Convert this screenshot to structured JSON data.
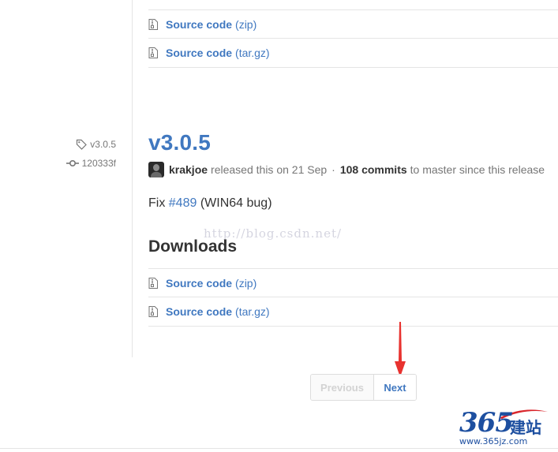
{
  "previous_release": {
    "downloads": [
      {
        "label": "Source code",
        "format": "(zip)"
      },
      {
        "label": "Source code",
        "format": "(tar.gz)"
      }
    ]
  },
  "release": {
    "tag": "v3.0.5",
    "commit": "120333f",
    "title": "v3.0.5",
    "author": "krakjoe",
    "released_text": "released this on 21 Sep",
    "separator": "·",
    "commits_count": "108 commits",
    "commits_suffix": "to master since this release",
    "notes_prefix": "Fix",
    "notes_issue": "#489",
    "notes_suffix": "(WIN64 bug)",
    "downloads_heading": "Downloads",
    "downloads": [
      {
        "label": "Source code",
        "format": "(zip)"
      },
      {
        "label": "Source code",
        "format": "(tar.gz)"
      }
    ]
  },
  "pagination": {
    "previous_label": "Previous",
    "next_label": "Next"
  },
  "watermark": "http://blog.csdn.net/",
  "logo": {
    "number": "365",
    "chinese": "建站",
    "url": "www.365jz.com"
  },
  "colors": {
    "link": "#4078c0",
    "text": "#333333",
    "muted": "#767676",
    "border": "#e5e5e5",
    "arrow": "#e8322f"
  },
  "icons": [
    "file-zip-icon",
    "tag-icon",
    "commit-icon",
    "avatar",
    "red-arrow-icon"
  ]
}
